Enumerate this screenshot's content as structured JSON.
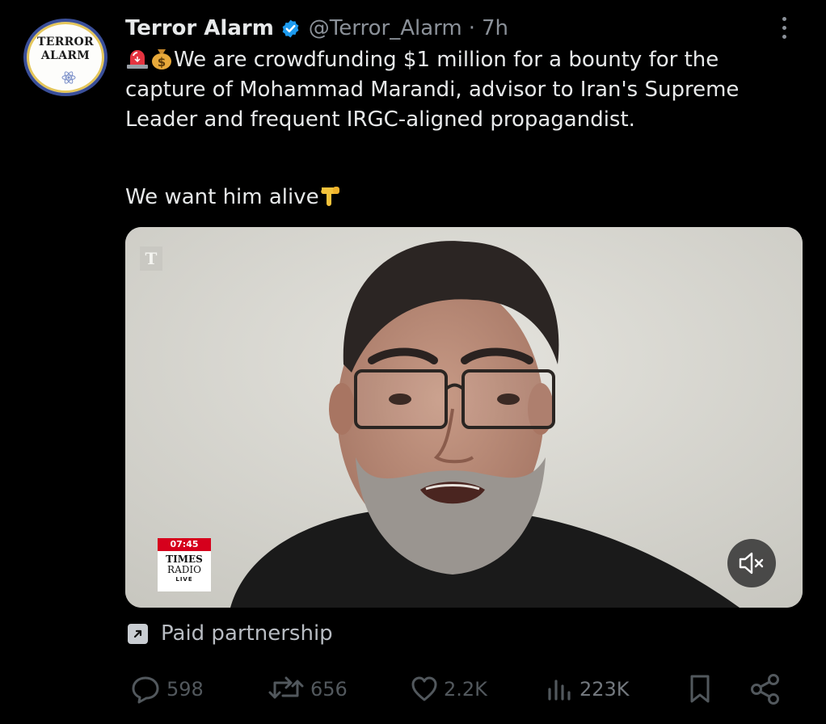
{
  "tweet": {
    "author": {
      "avatar_text_line1": "TERROR",
      "avatar_text_line2": "ALARM",
      "display_name": "Terror Alarm",
      "verified_icon": "verified-badge-icon",
      "handle": "@Terror_Alarm",
      "separator": "·",
      "time": "7h"
    },
    "text": "We are crowdfunding $1 million for a bounty for the capture of Mohammad Marandi, advisor to Iran's Supreme Leader and frequent IRGC-aligned propagandist.",
    "text_emojis": [
      "siren-emoji",
      "money-bag-emoji"
    ],
    "text2": "We want him alive",
    "text2_emoji": "pointing-down-emoji",
    "media": {
      "channel_logo": "T",
      "badge_time": "07:45",
      "badge_brand_line1": "TIMES",
      "badge_brand_line2": "RADIO",
      "badge_live": "LIVE",
      "mute_icon": "volume-muted-icon"
    },
    "paid_label": "Paid partnership",
    "actions": {
      "replies": "598",
      "reposts": "656",
      "likes": "2.2K",
      "views": "223K"
    }
  },
  "colors": {
    "background": "#000000",
    "text_primary": "#e7e9ea",
    "text_secondary": "#8b9199",
    "verified_blue": "#1d9bf0"
  }
}
